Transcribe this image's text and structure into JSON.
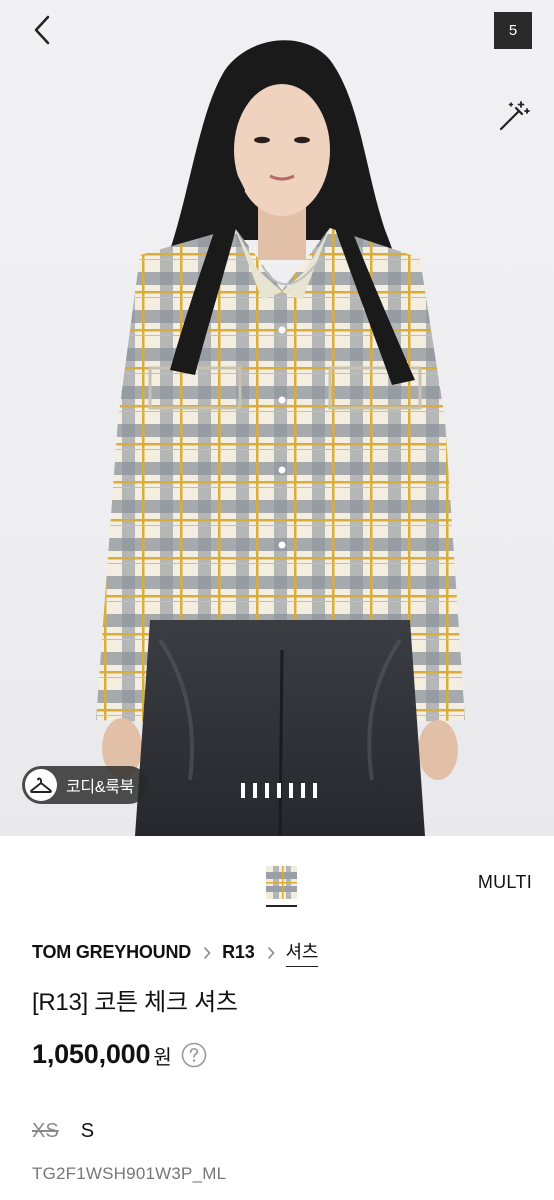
{
  "gallery": {
    "image_count_badge": "5",
    "cody_label": "코디&룩북",
    "pager_segments": 7,
    "icons": {
      "back": "chevron-left-icon",
      "magic": "magic-wand-icon",
      "cody": "hanger-icon"
    }
  },
  "product": {
    "color_name": "MULTI",
    "breadcrumb": {
      "brand": "TOM GREYHOUND",
      "sub_brand": "R13",
      "category": "셔츠"
    },
    "title": "[R13] 코튼 체크 셔츠",
    "price": "1,050,000",
    "currency": "원",
    "sizes": [
      {
        "label": "XS",
        "sold_out": true
      },
      {
        "label": "S",
        "sold_out": false
      }
    ],
    "sku": "TG2F1WSH901W3P_ML"
  },
  "colors": {
    "badge_bg": "#2a2a2a",
    "text": "#111111",
    "muted": "#777777"
  }
}
